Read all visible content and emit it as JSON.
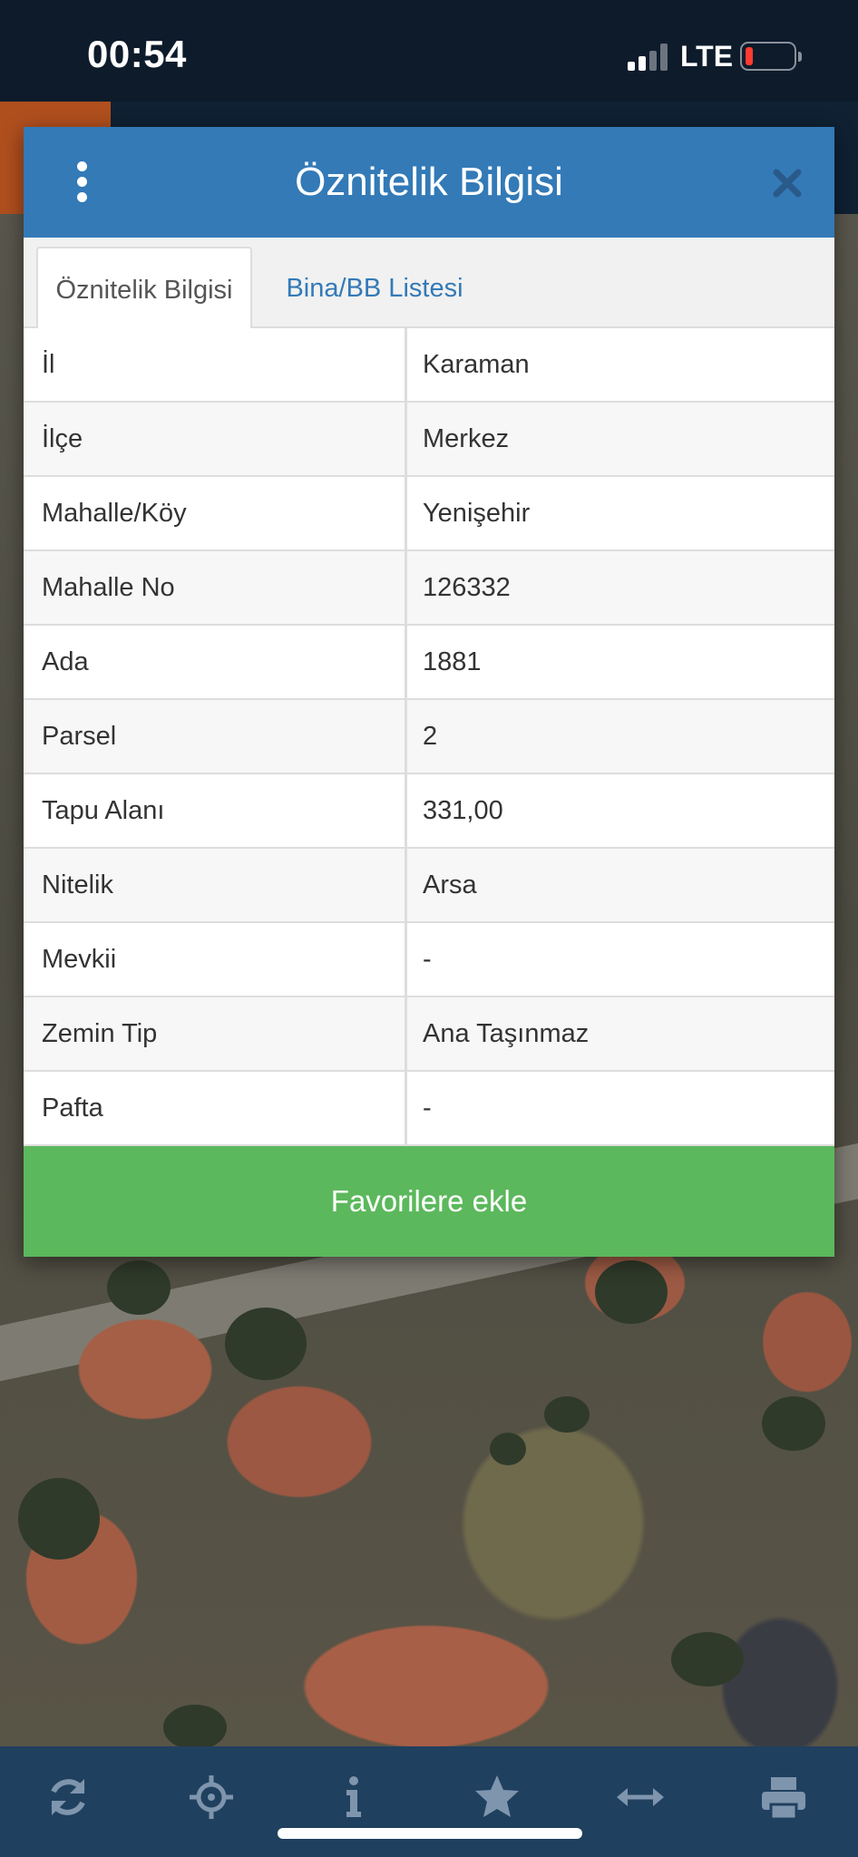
{
  "status_bar": {
    "time": "00:54",
    "network": "LTE",
    "signal_bars": 2,
    "battery_level": 0.1
  },
  "dialog": {
    "title": "Öznitelik Bilgisi",
    "menu_icon": "more-vertical-icon",
    "close_icon": "close-icon",
    "tabs": [
      {
        "label": "Öznitelik Bilgisi",
        "active": true
      },
      {
        "label": "Bina/BB Listesi",
        "active": false
      }
    ],
    "rows": [
      {
        "key": "İl",
        "value": "Karaman"
      },
      {
        "key": "İlçe",
        "value": "Merkez"
      },
      {
        "key": "Mahalle/Köy",
        "value": "Yenişehir"
      },
      {
        "key": "Mahalle No",
        "value": "126332"
      },
      {
        "key": "Ada",
        "value": "1881"
      },
      {
        "key": "Parsel",
        "value": "2"
      },
      {
        "key": "Tapu Alanı",
        "value": "331,00"
      },
      {
        "key": "Nitelik",
        "value": "Arsa"
      },
      {
        "key": "Mevkii",
        "value": "-"
      },
      {
        "key": "Zemin Tip",
        "value": "Ana Taşınmaz"
      },
      {
        "key": "Pafta",
        "value": "-"
      }
    ],
    "favorite_button": "Favorilere ekle"
  },
  "toolbar": {
    "items": [
      "refresh-icon",
      "locate-icon",
      "info-icon",
      "star-icon",
      "measure-icon",
      "print-icon"
    ]
  },
  "colors": {
    "header": "#337ab7",
    "favorite": "#5cb85c",
    "toolbar": "#20405f",
    "toolbar_icon": "#7e95ad",
    "status_bar": "#0d1b2b"
  }
}
